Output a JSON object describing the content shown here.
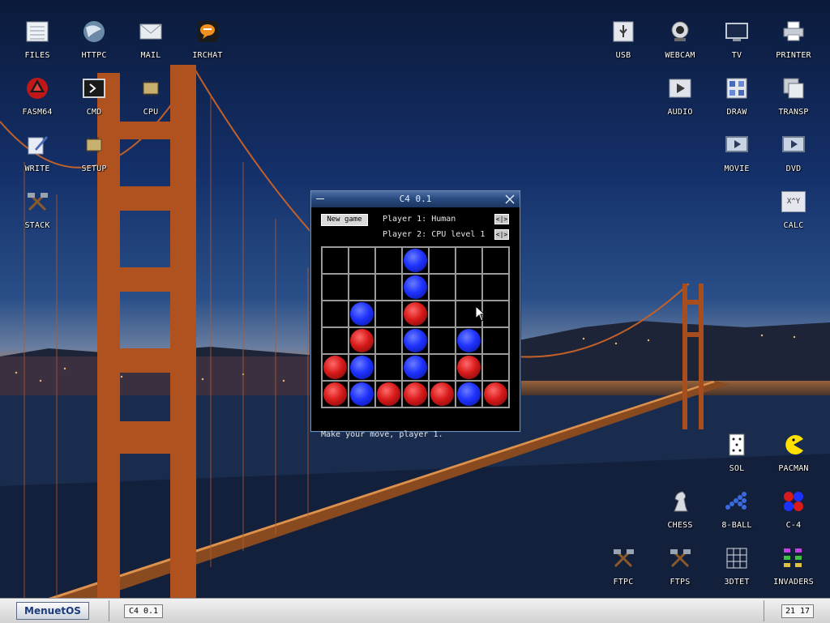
{
  "desktop": {
    "left_icons": [
      {
        "label": "FILES",
        "icon": "files-icon"
      },
      {
        "label": "HTTPC",
        "icon": "httpc-icon"
      },
      {
        "label": "MAIL",
        "icon": "mail-icon"
      },
      {
        "label": "IRCHAT",
        "icon": "irchat-icon"
      },
      {
        "label": "FASM64",
        "icon": "fasm64-icon"
      },
      {
        "label": "CMD",
        "icon": "cmd-icon"
      },
      {
        "label": "CPU",
        "icon": "cpu-icon"
      },
      {
        "label": "WRITE",
        "icon": "write-icon"
      },
      {
        "label": "SETUP",
        "icon": "setup-icon"
      },
      {
        "label": "STACK",
        "icon": "stack-icon"
      }
    ],
    "right_icons": [
      {
        "label": "USB",
        "icon": "usb-icon"
      },
      {
        "label": "WEBCAM",
        "icon": "webcam-icon"
      },
      {
        "label": "TV",
        "icon": "tv-icon"
      },
      {
        "label": "PRINTER",
        "icon": "printer-icon"
      },
      {
        "label": "AUDIO",
        "icon": "audio-icon"
      },
      {
        "label": "DRAW",
        "icon": "draw-icon"
      },
      {
        "label": "TRANSP",
        "icon": "transp-icon"
      },
      {
        "label": "MOVIE",
        "icon": "movie-icon"
      },
      {
        "label": "DVD",
        "icon": "dvd-icon"
      },
      {
        "label": "CALC",
        "icon": "calc-icon",
        "glyph_text": "X^Y"
      },
      {
        "label": "SOL",
        "icon": "sol-icon"
      },
      {
        "label": "PACMAN",
        "icon": "pacman-icon"
      },
      {
        "label": "CHESS",
        "icon": "chess-icon"
      },
      {
        "label": "8-BALL",
        "icon": "8-ball-icon"
      },
      {
        "label": "C-4",
        "icon": "c-4-icon"
      },
      {
        "label": "FTPC",
        "icon": "ftpc-icon"
      },
      {
        "label": "FTPS",
        "icon": "ftps-icon"
      },
      {
        "label": "3DTET",
        "icon": "3dtet-icon"
      },
      {
        "label": "INVADERS",
        "icon": "invaders-icon"
      }
    ]
  },
  "window": {
    "title": "C4 0.1",
    "new_game_label": "New game",
    "player1_label": "Player 1: Human",
    "player2_label": "Player 2: CPU level 1",
    "arrows_label": "<|>",
    "status": "Make your move, player 1.",
    "board_cols": 7,
    "board_rows": 6,
    "board": [
      [
        "",
        "",
        "",
        "B",
        "",
        "",
        ""
      ],
      [
        "",
        "",
        "",
        "B",
        "",
        "",
        ""
      ],
      [
        "",
        "B",
        "",
        "R",
        "",
        "",
        ""
      ],
      [
        "",
        "R",
        "",
        "B",
        "",
        "B",
        ""
      ],
      [
        "R",
        "B",
        "",
        "B",
        "",
        "R",
        ""
      ],
      [
        "R",
        "B",
        "R",
        "R",
        "R",
        "B",
        "R"
      ]
    ],
    "colors": {
      "player1": "#1e32ff",
      "player2": "#d81a1a"
    }
  },
  "taskbar": {
    "menu_label": "MenuetOS",
    "task_label": "C4 0.1",
    "clock": "21 17"
  }
}
